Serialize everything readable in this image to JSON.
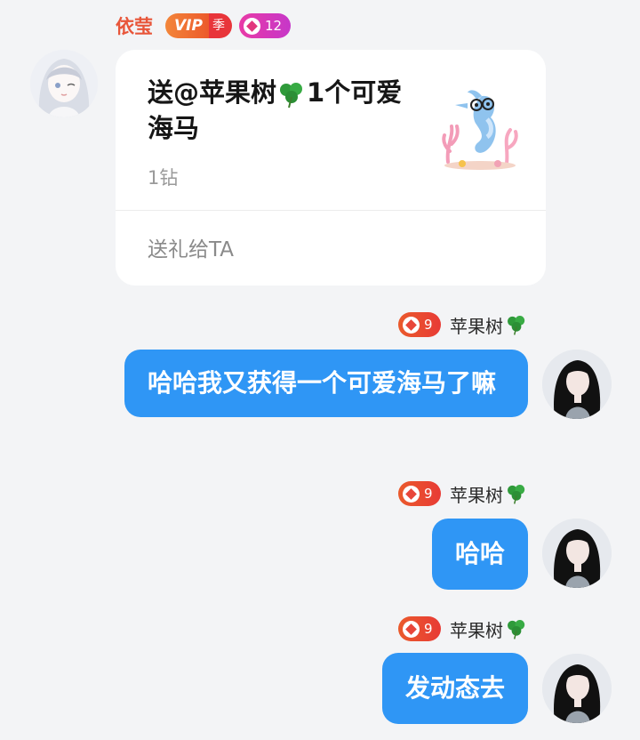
{
  "gift_message": {
    "sender_name": "依莹",
    "vip_label": "VIP",
    "vip_season_label": "季",
    "fan_level": "12",
    "title_text": "送@苹果树",
    "title_suffix": "1个可爱海马",
    "price": "1钻",
    "action_label": "送礼给TA",
    "gift_icon": "seahorse-gift-icon"
  },
  "outgoing_messages": [
    {
      "user_level": "9",
      "user_name": "苹果树",
      "text": "哈哈我又获得一个可爱海马了嘛"
    },
    {
      "user_level": "9",
      "user_name": "苹果树",
      "text": "哈哈"
    },
    {
      "user_level": "9",
      "user_name": "苹果树",
      "text": "发动态去"
    }
  ],
  "colors": {
    "background": "#f3f4f6",
    "bubble_blue": "#2f96f5",
    "sender_name": "#e8563a",
    "card": "#ffffff"
  }
}
